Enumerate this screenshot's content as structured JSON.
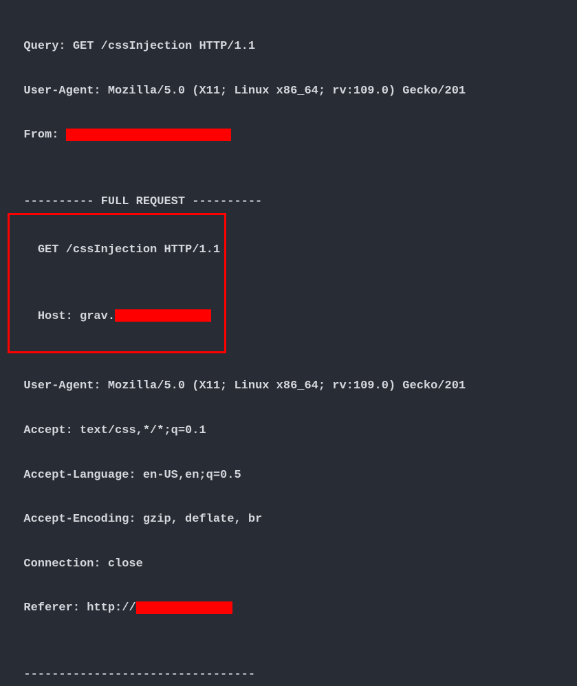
{
  "summary": {
    "query_label": "Query: ",
    "query_value": "GET /cssInjection HTTP/1.1",
    "useragent_label": "User-Agent: ",
    "useragent_value": "Mozilla/5.0 (X11; Linux x86_64; rv:109.0) Gecko/201",
    "from_label": "From: "
  },
  "divider_full_request": "---------- FULL REQUEST ----------",
  "request": {
    "request_line": "GET /cssInjection HTTP/1.1",
    "host_label": "Host: ",
    "host_prefix": "grav.",
    "useragent_label": "User-Agent: ",
    "useragent_value": "Mozilla/5.0 (X11; Linux x86_64; rv:109.0) Gecko/201",
    "accept_label": "Accept: ",
    "accept_value": "text/css,*/*;q=0.1",
    "accept_language_label": "Accept-Language: ",
    "accept_language_value": "en-US,en;q=0.5",
    "accept_encoding_label": "Accept-Encoding: ",
    "accept_encoding_value": "gzip, deflate, br",
    "connection_label": "Connection: ",
    "connection_value": "close",
    "referer_label": "Referer: ",
    "referer_prefix": "http://"
  },
  "divider_bottom": "---------------------------------"
}
